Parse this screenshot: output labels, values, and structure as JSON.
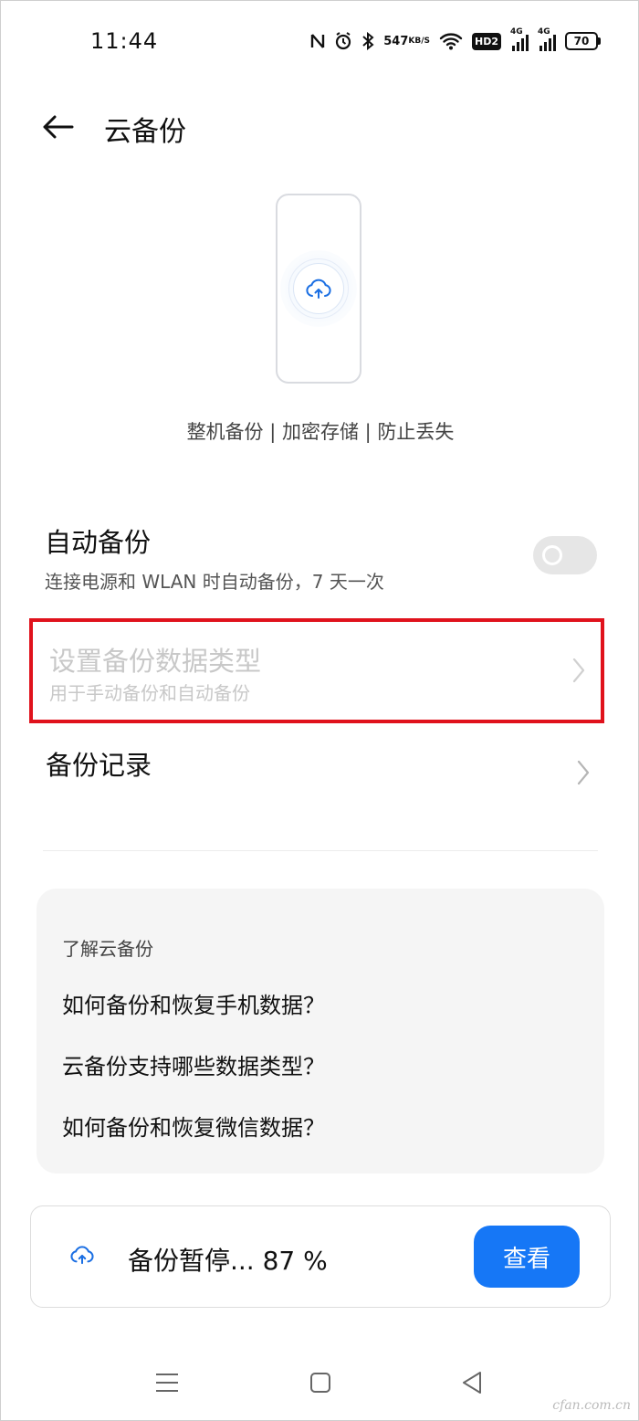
{
  "status_bar": {
    "time": "11:44",
    "net_speed_value": "547",
    "net_speed_unit": "KB/S",
    "hd_badge": "HD2",
    "sim1_label": "4G",
    "sim2_label": "4G",
    "battery_level": "70"
  },
  "header": {
    "title": "云备份"
  },
  "hero": {
    "tagline": "整机备份 | 加密存储 | 防止丢失"
  },
  "auto_backup": {
    "title": "自动备份",
    "subtitle": "连接电源和 WLAN 时自动备份，7 天一次",
    "enabled": false
  },
  "backup_type": {
    "title": "设置备份数据类型",
    "subtitle": "用于手动备份和自动备份",
    "disabled": true
  },
  "backup_record": {
    "title": "备份记录"
  },
  "learn": {
    "heading": "了解云备份",
    "links": [
      "如何备份和恢复手机数据？",
      "云备份支持哪些数据类型？",
      "如何备份和恢复微信数据？"
    ]
  },
  "backup_status": {
    "text": "备份暂停... 87 %",
    "progress_percent": 87,
    "view_button": "查看"
  },
  "watermark": "cfan.com.cn",
  "colors": {
    "accent": "#1677f6",
    "highlight_border": "#e0121c",
    "disabled_text": "#c8c8c8",
    "card_bg": "#f5f5f5"
  }
}
